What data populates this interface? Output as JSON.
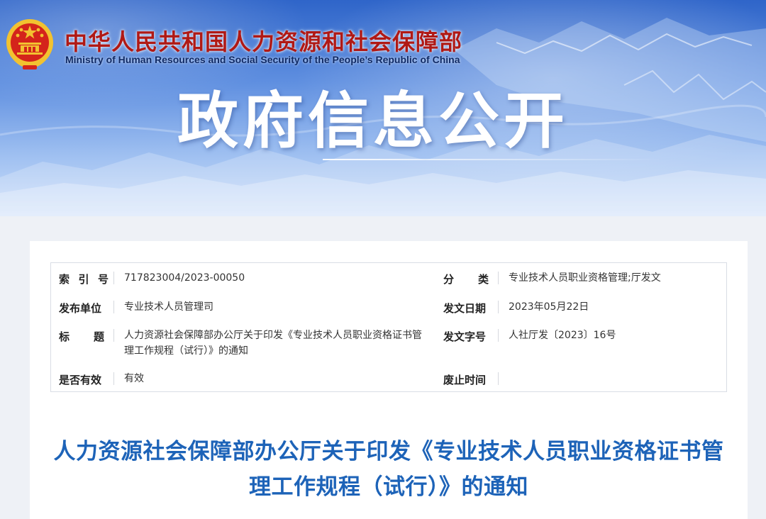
{
  "header": {
    "ministry_cn": "中华人民共和国人力资源和社会保障部",
    "ministry_en": "Ministry of Human Resources and Social Security of the People’s Republic of China",
    "section_title": "政府信息公开"
  },
  "meta": {
    "index_label": "索 引 号",
    "index_value": "717823004/2023-00050",
    "category_label": "分 类",
    "category_value": "专业技术人员职业资格管理;厅发文",
    "publisher_label": "发布单位",
    "publisher_value": "专业技术人员管理司",
    "date_label": "发文日期",
    "date_value": "2023年05月22日",
    "title_label": "标 题",
    "title_value": "人力资源社会保障部办公厅关于印发《专业技术人员职业资格证书管理工作规程（试行）》的通知",
    "doc_no_label": "发文字号",
    "doc_no_value": "人社厅发〔2023〕16号",
    "valid_label": "是否有效",
    "valid_value": "有效",
    "expiry_label": "废止时间",
    "expiry_value": ""
  },
  "document": {
    "title": "人力资源社会保障部办公厅关于印发《专业技术人员职业资格证书管理工作规程（试行）》的通知"
  },
  "colors": {
    "banner_top": "#2f65c9",
    "ministry_red": "#b01915",
    "title_blue": "#1d63b8",
    "emblem_gold": "#f2c230"
  }
}
